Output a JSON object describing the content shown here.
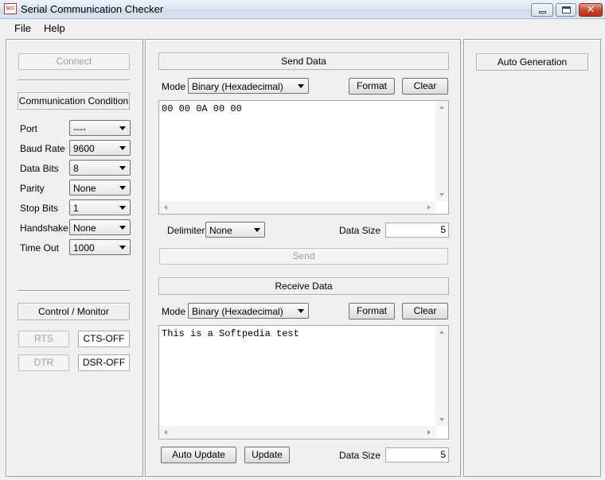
{
  "window": {
    "title": "Serial Communication Checker",
    "icon_text": "SCC",
    "close_glyph": "✕"
  },
  "menu": {
    "items": [
      "File",
      "Help"
    ]
  },
  "left": {
    "connect_label": "Connect",
    "comm_condition_title": "Communication Condition",
    "settings": [
      {
        "label": "Port",
        "value": "----"
      },
      {
        "label": "Baud Rate",
        "value": "9600"
      },
      {
        "label": "Data Bits",
        "value": "8"
      },
      {
        "label": "Parity",
        "value": "None"
      },
      {
        "label": "Stop Bits",
        "value": "1"
      },
      {
        "label": "Handshake",
        "value": "None"
      },
      {
        "label": "Time Out",
        "value": "1000"
      }
    ],
    "control_title": "Control / Monitor",
    "rts_label": "RTS",
    "cts_status": "CTS-OFF",
    "dtr_label": "DTR",
    "dsr_status": "DSR-OFF"
  },
  "send": {
    "title": "Send Data",
    "mode_label": "Mode",
    "mode_value": "Binary (Hexadecimal)",
    "format_label": "Format",
    "clear_label": "Clear",
    "content": "00 00 0A 00 00",
    "delimiter_label": "Delimiter",
    "delimiter_value": "None",
    "data_size_label": "Data Size",
    "data_size_value": "5",
    "send_label": "Send"
  },
  "receive": {
    "title": "Receive Data",
    "mode_label": "Mode",
    "mode_value": "Binary (Hexadecimal)",
    "format_label": "Format",
    "clear_label": "Clear",
    "content": "This is a Softpedia test",
    "auto_update_label": "Auto Update",
    "update_label": "Update",
    "data_size_label": "Data Size",
    "data_size_value": "5"
  },
  "right": {
    "auto_generation_title": "Auto Generation"
  }
}
